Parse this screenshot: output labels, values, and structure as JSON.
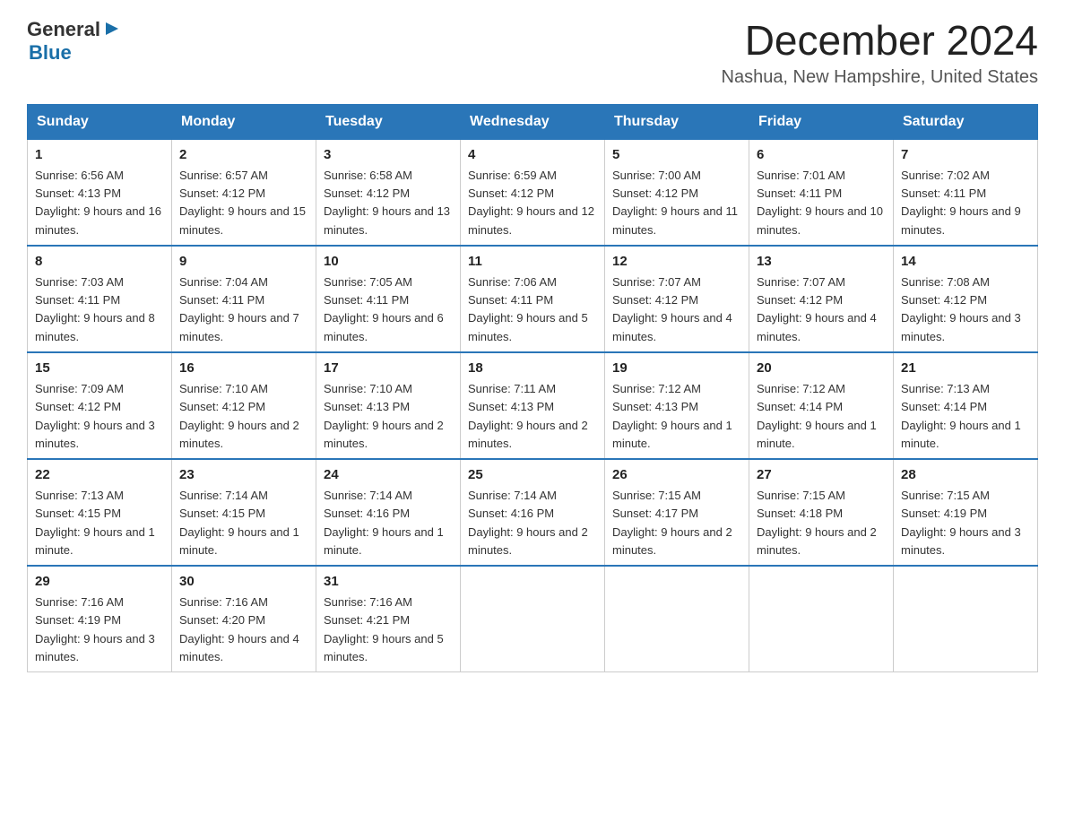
{
  "header": {
    "logo": {
      "general": "General",
      "arrow": "▶",
      "blue": "Blue"
    },
    "title": "December 2024",
    "location": "Nashua, New Hampshire, United States"
  },
  "calendar": {
    "days_of_week": [
      "Sunday",
      "Monday",
      "Tuesday",
      "Wednesday",
      "Thursday",
      "Friday",
      "Saturday"
    ],
    "weeks": [
      [
        {
          "day": "1",
          "sunrise": "6:56 AM",
          "sunset": "4:13 PM",
          "daylight": "9 hours and 16 minutes."
        },
        {
          "day": "2",
          "sunrise": "6:57 AM",
          "sunset": "4:12 PM",
          "daylight": "9 hours and 15 minutes."
        },
        {
          "day": "3",
          "sunrise": "6:58 AM",
          "sunset": "4:12 PM",
          "daylight": "9 hours and 13 minutes."
        },
        {
          "day": "4",
          "sunrise": "6:59 AM",
          "sunset": "4:12 PM",
          "daylight": "9 hours and 12 minutes."
        },
        {
          "day": "5",
          "sunrise": "7:00 AM",
          "sunset": "4:12 PM",
          "daylight": "9 hours and 11 minutes."
        },
        {
          "day": "6",
          "sunrise": "7:01 AM",
          "sunset": "4:11 PM",
          "daylight": "9 hours and 10 minutes."
        },
        {
          "day": "7",
          "sunrise": "7:02 AM",
          "sunset": "4:11 PM",
          "daylight": "9 hours and 9 minutes."
        }
      ],
      [
        {
          "day": "8",
          "sunrise": "7:03 AM",
          "sunset": "4:11 PM",
          "daylight": "9 hours and 8 minutes."
        },
        {
          "day": "9",
          "sunrise": "7:04 AM",
          "sunset": "4:11 PM",
          "daylight": "9 hours and 7 minutes."
        },
        {
          "day": "10",
          "sunrise": "7:05 AM",
          "sunset": "4:11 PM",
          "daylight": "9 hours and 6 minutes."
        },
        {
          "day": "11",
          "sunrise": "7:06 AM",
          "sunset": "4:11 PM",
          "daylight": "9 hours and 5 minutes."
        },
        {
          "day": "12",
          "sunrise": "7:07 AM",
          "sunset": "4:12 PM",
          "daylight": "9 hours and 4 minutes."
        },
        {
          "day": "13",
          "sunrise": "7:07 AM",
          "sunset": "4:12 PM",
          "daylight": "9 hours and 4 minutes."
        },
        {
          "day": "14",
          "sunrise": "7:08 AM",
          "sunset": "4:12 PM",
          "daylight": "9 hours and 3 minutes."
        }
      ],
      [
        {
          "day": "15",
          "sunrise": "7:09 AM",
          "sunset": "4:12 PM",
          "daylight": "9 hours and 3 minutes."
        },
        {
          "day": "16",
          "sunrise": "7:10 AM",
          "sunset": "4:12 PM",
          "daylight": "9 hours and 2 minutes."
        },
        {
          "day": "17",
          "sunrise": "7:10 AM",
          "sunset": "4:13 PM",
          "daylight": "9 hours and 2 minutes."
        },
        {
          "day": "18",
          "sunrise": "7:11 AM",
          "sunset": "4:13 PM",
          "daylight": "9 hours and 2 minutes."
        },
        {
          "day": "19",
          "sunrise": "7:12 AM",
          "sunset": "4:13 PM",
          "daylight": "9 hours and 1 minute."
        },
        {
          "day": "20",
          "sunrise": "7:12 AM",
          "sunset": "4:14 PM",
          "daylight": "9 hours and 1 minute."
        },
        {
          "day": "21",
          "sunrise": "7:13 AM",
          "sunset": "4:14 PM",
          "daylight": "9 hours and 1 minute."
        }
      ],
      [
        {
          "day": "22",
          "sunrise": "7:13 AM",
          "sunset": "4:15 PM",
          "daylight": "9 hours and 1 minute."
        },
        {
          "day": "23",
          "sunrise": "7:14 AM",
          "sunset": "4:15 PM",
          "daylight": "9 hours and 1 minute."
        },
        {
          "day": "24",
          "sunrise": "7:14 AM",
          "sunset": "4:16 PM",
          "daylight": "9 hours and 1 minute."
        },
        {
          "day": "25",
          "sunrise": "7:14 AM",
          "sunset": "4:16 PM",
          "daylight": "9 hours and 2 minutes."
        },
        {
          "day": "26",
          "sunrise": "7:15 AM",
          "sunset": "4:17 PM",
          "daylight": "9 hours and 2 minutes."
        },
        {
          "day": "27",
          "sunrise": "7:15 AM",
          "sunset": "4:18 PM",
          "daylight": "9 hours and 2 minutes."
        },
        {
          "day": "28",
          "sunrise": "7:15 AM",
          "sunset": "4:19 PM",
          "daylight": "9 hours and 3 minutes."
        }
      ],
      [
        {
          "day": "29",
          "sunrise": "7:16 AM",
          "sunset": "4:19 PM",
          "daylight": "9 hours and 3 minutes."
        },
        {
          "day": "30",
          "sunrise": "7:16 AM",
          "sunset": "4:20 PM",
          "daylight": "9 hours and 4 minutes."
        },
        {
          "day": "31",
          "sunrise": "7:16 AM",
          "sunset": "4:21 PM",
          "daylight": "9 hours and 5 minutes."
        },
        null,
        null,
        null,
        null
      ]
    ]
  }
}
